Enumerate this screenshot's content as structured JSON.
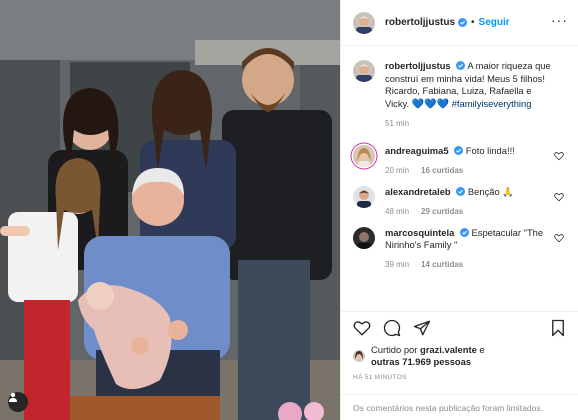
{
  "post": {
    "author": {
      "username": "robertoljjustus",
      "verified": true,
      "follow_label": "Seguir",
      "more_icon": "ellipsis-icon"
    },
    "caption": {
      "username": "robertoljjustus",
      "text": "A maior riqueza que construí em minha vida! Meus 5 filhos! Ricardo, Fabiana, Luiza, Rafaella e Vicky.",
      "emojis": "💙💙💙",
      "hashtag": "#familyiseverything",
      "age": "51 min"
    },
    "comments": [
      {
        "username": "andreaguima5",
        "verified": true,
        "text": "Foto linda!!!",
        "age": "20 min",
        "likes": "16 curtidas"
      },
      {
        "username": "alexandretaleb",
        "verified": true,
        "text": "Benção 🙏",
        "age": "48 min",
        "likes": "29 curtidas"
      },
      {
        "username": "marcosquintela",
        "verified": true,
        "text": "Espetacular \"The Nirinho's Family \"",
        "age": "39 min",
        "likes": "14 curtidas"
      }
    ],
    "likes": {
      "prefix": "Curtido por",
      "first_user": "grazi.valente",
      "connector": "e",
      "others": "outras 71.969 pessoas"
    },
    "timestamp": "HÁ 51 MINUTOS",
    "comments_limited": "Os comentários nesta publicação foram limitados.",
    "colors": {
      "accent": "#0095f6",
      "verified": "#3897f0",
      "muted": "#8e8e8e",
      "text": "#262626"
    }
  }
}
